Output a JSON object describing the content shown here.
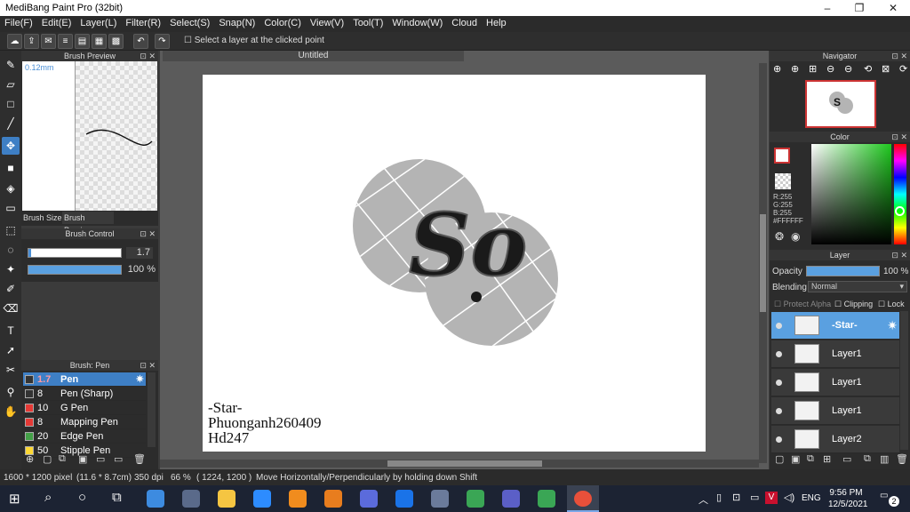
{
  "window": {
    "title": "MediBang Paint Pro (32bit)",
    "min": "–",
    "max": "❐",
    "close": "✕"
  },
  "menu": [
    "File(F)",
    "Edit(E)",
    "Layer(L)",
    "Filter(R)",
    "Select(S)",
    "Snap(N)",
    "Color(C)",
    "View(V)",
    "Tool(T)",
    "Window(W)",
    "Cloud",
    "Help"
  ],
  "toolbar": {
    "option_label": "Select a layer at the clicked point"
  },
  "canvas": {
    "tab_title": "Untitled",
    "text_lines": [
      "-Star-",
      "Phuonganh260409",
      "Hd247"
    ],
    "art_text": "So"
  },
  "brush_preview": {
    "title": "Brush Preview",
    "size_label": "0.12mm",
    "tab1": "Brush Size",
    "tab2": "Brush Preview"
  },
  "brush_control": {
    "title": "Brush Control",
    "size_value": "1.7",
    "opacity_value": "100 %"
  },
  "brush_list": {
    "title": "Brush: Pen",
    "items": [
      {
        "size": "1.7",
        "name": "Pen",
        "color": "#333333",
        "selected": true
      },
      {
        "size": "8",
        "name": "Pen (Sharp)",
        "color": "#333333",
        "selected": false
      },
      {
        "size": "10",
        "name": "G Pen",
        "color": "#e53935",
        "selected": false
      },
      {
        "size": "8",
        "name": "Mapping Pen",
        "color": "#e53935",
        "selected": false
      },
      {
        "size": "20",
        "name": "Edge Pen",
        "color": "#43a047",
        "selected": false
      },
      {
        "size": "50",
        "name": "Stipple Pen",
        "color": "#fdd835",
        "selected": false
      }
    ]
  },
  "navigator": {
    "title": "Navigator"
  },
  "color": {
    "title": "Color",
    "r": "R:255",
    "g": "G:255",
    "b": "B:255",
    "hex": "#FFFFFF"
  },
  "layer": {
    "title": "Layer",
    "opacity_label": "Opacity",
    "opacity_value": "100 %",
    "blending_label": "Blending",
    "blending_value": "Normal",
    "protect_alpha": "Protect Alpha",
    "clipping": "Clipping",
    "lock": "Lock",
    "layers": [
      {
        "name": "-Star-",
        "selected": true
      },
      {
        "name": "Layer1",
        "selected": false
      },
      {
        "name": "Layer1",
        "selected": false
      },
      {
        "name": "Layer1",
        "selected": false
      },
      {
        "name": "Layer2",
        "selected": false
      }
    ]
  },
  "status": {
    "size": "1600 * 1200 pixel",
    "physical": "(11.6 * 8.7cm)",
    "dpi": "350 dpi",
    "zoom": "66 %",
    "coords": "( 1224, 1200 )",
    "hint": "Move Horizontally/Perpendicularly by holding down Shift"
  },
  "taskbar": {
    "time": "9:56 PM",
    "date": "12/5/2021",
    "lang": "ENG",
    "notif": "2"
  }
}
